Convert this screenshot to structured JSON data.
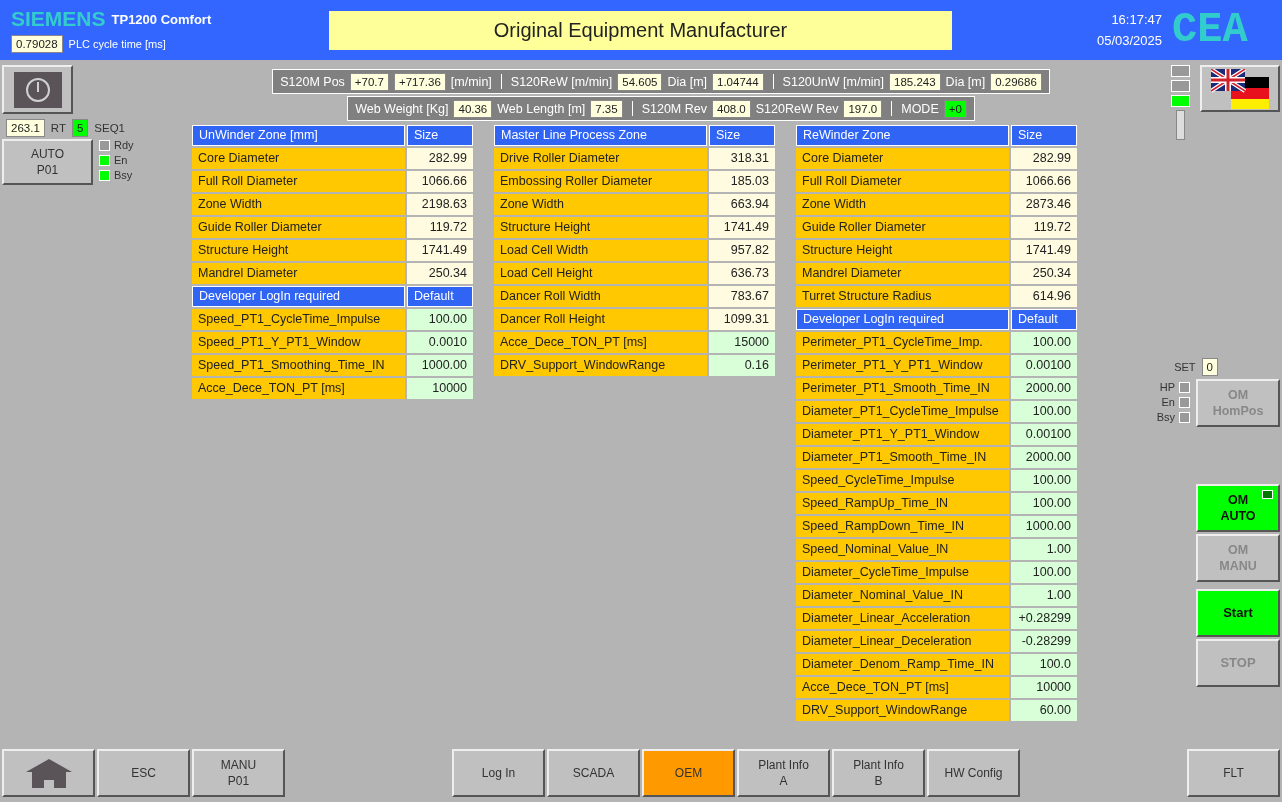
{
  "header": {
    "brand": "SIEMENS",
    "model": "TP1200 Comfort",
    "cycle_time": "0.79028",
    "cycle_time_label": "PLC cycle time [ms]",
    "title": "Original Equipment Manufacturer",
    "time": "16:17:47",
    "date": "05/03/2025",
    "logo": "CEA"
  },
  "left_panel": {
    "rt_value": "263.1",
    "rt_label": "RT",
    "seq_value": "5",
    "seq_label": "SEQ1",
    "mode_button": "AUTO\nP01",
    "indicators": [
      {
        "label": "Rdy",
        "on": false
      },
      {
        "label": "En",
        "on": true
      },
      {
        "label": "Bsy",
        "on": true
      }
    ]
  },
  "info_bars": [
    {
      "items": [
        {
          "kind": "label",
          "text": "S120M Pos"
        },
        {
          "kind": "value",
          "text": "+70.7"
        },
        {
          "kind": "value",
          "text": "+717.36"
        },
        {
          "kind": "label",
          "text": "[m/min]"
        },
        {
          "kind": "separator"
        },
        {
          "kind": "label",
          "text": "S120ReW [m/min]"
        },
        {
          "kind": "value",
          "text": "54.605"
        },
        {
          "kind": "label",
          "text": "Dia [m]"
        },
        {
          "kind": "value",
          "text": "1.04744"
        },
        {
          "kind": "separator"
        },
        {
          "kind": "label",
          "text": "S120UnW [m/min]"
        },
        {
          "kind": "value",
          "text": "185.243"
        },
        {
          "kind": "label",
          "text": "Dia [m]"
        },
        {
          "kind": "value",
          "text": "0.29686"
        }
      ]
    },
    {
      "items": [
        {
          "kind": "label",
          "text": "Web Weight [Kg]"
        },
        {
          "kind": "value",
          "text": "40.36"
        },
        {
          "kind": "label",
          "text": "Web Length [m]"
        },
        {
          "kind": "value",
          "text": "7.35"
        },
        {
          "kind": "separator"
        },
        {
          "kind": "label",
          "text": "S120M Rev"
        },
        {
          "kind": "value",
          "text": "408.0"
        },
        {
          "kind": "label",
          "text": "S120ReW Rev"
        },
        {
          "kind": "value",
          "text": "197.0"
        },
        {
          "kind": "separator"
        },
        {
          "kind": "label",
          "text": "MODE"
        },
        {
          "kind": "active_value",
          "text": "+0"
        }
      ]
    }
  ],
  "tables": [
    {
      "rows": [
        {
          "kind": "header",
          "label": "UnWinder Zone [mm]",
          "value": "Size"
        },
        {
          "kind": "size",
          "label": "Core Diameter",
          "value": "282.99"
        },
        {
          "kind": "size",
          "label": "Full Roll Diameter",
          "value": "1066.66"
        },
        {
          "kind": "size",
          "label": "Zone Width",
          "value": "2198.63"
        },
        {
          "kind": "size",
          "label": "Guide Roller Diameter",
          "value": "119.72"
        },
        {
          "kind": "size",
          "label": "Structure Height",
          "value": "1741.49"
        },
        {
          "kind": "size",
          "label": "Mandrel Diameter",
          "value": "250.34"
        },
        {
          "kind": "header",
          "label": "Developer LogIn required",
          "value": "Default"
        },
        {
          "kind": "default",
          "label": "Speed_PT1_CycleTime_Impulse",
          "value": "100.00"
        },
        {
          "kind": "default",
          "label": "Speed_PT1_Y_PT1_Window",
          "value": "0.0010"
        },
        {
          "kind": "default",
          "label": "Speed_PT1_Smoothing_Time_IN",
          "value": "1000.00"
        },
        {
          "kind": "default",
          "label": "Acce_Dece_TON_PT [ms]",
          "value": "10000"
        }
      ]
    },
    {
      "rows": [
        {
          "kind": "header",
          "label": "Master Line Process Zone",
          "value": "Size"
        },
        {
          "kind": "size",
          "label": "Drive Roller Diameter",
          "value": "318.31"
        },
        {
          "kind": "size",
          "label": "Embossing Roller Diameter",
          "value": "185.03"
        },
        {
          "kind": "size",
          "label": "Zone Width",
          "value": "663.94"
        },
        {
          "kind": "size",
          "label": "Structure Height",
          "value": "1741.49"
        },
        {
          "kind": "size",
          "label": "Load Cell Width",
          "value": "957.82"
        },
        {
          "kind": "size",
          "label": "Load Cell Height",
          "value": "636.73"
        },
        {
          "kind": "size",
          "label": "Dancer Roll Width",
          "value": "783.67"
        },
        {
          "kind": "size",
          "label": "Dancer Roll Height",
          "value": "1099.31"
        },
        {
          "kind": "default",
          "label": "Acce_Dece_TON_PT [ms]",
          "value": "15000"
        },
        {
          "kind": "default",
          "label": "DRV_Support_WindowRange",
          "value": "0.16"
        }
      ]
    },
    {
      "rows": [
        {
          "kind": "header",
          "label": "ReWinder Zone",
          "value": "Size"
        },
        {
          "kind": "size",
          "label": "Core Diameter",
          "value": "282.99"
        },
        {
          "kind": "size",
          "label": "Full Roll Diameter",
          "value": "1066.66"
        },
        {
          "kind": "size",
          "label": "Zone Width",
          "value": "2873.46"
        },
        {
          "kind": "size",
          "label": "Guide Roller Diameter",
          "value": "119.72"
        },
        {
          "kind": "size",
          "label": "Structure Height",
          "value": "1741.49"
        },
        {
          "kind": "size",
          "label": "Mandrel Diameter",
          "value": "250.34"
        },
        {
          "kind": "size",
          "label": "Turret Structure Radius",
          "value": "614.96"
        },
        {
          "kind": "header",
          "label": "Developer LogIn required",
          "value": "Default"
        },
        {
          "kind": "default",
          "label": "Perimeter_PT1_CycleTime_Imp.",
          "value": "100.00"
        },
        {
          "kind": "default",
          "label": "Perimeter_PT1_Y_PT1_Window",
          "value": "0.00100"
        },
        {
          "kind": "default",
          "label": "Perimeter_PT1_Smooth_Time_IN",
          "value": "2000.00"
        },
        {
          "kind": "default",
          "label": "Diameter_PT1_CycleTime_Impulse",
          "value": "100.00"
        },
        {
          "kind": "default",
          "label": "Diameter_PT1_Y_PT1_Window",
          "value": "0.00100"
        },
        {
          "kind": "default",
          "label": "Diameter_PT1_Smooth_Time_IN",
          "value": "2000.00"
        },
        {
          "kind": "default",
          "label": "Speed_CycleTime_Impulse",
          "value": "100.00"
        },
        {
          "kind": "default",
          "label": "Speed_RampUp_Time_IN",
          "value": "100.00"
        },
        {
          "kind": "default",
          "label": "Speed_RampDown_Time_IN",
          "value": "1000.00"
        },
        {
          "kind": "default",
          "label": "Speed_Nominal_Value_IN",
          "value": "1.00"
        },
        {
          "kind": "default",
          "label": "Diameter_CycleTime_Impulse",
          "value": "100.00"
        },
        {
          "kind": "default",
          "label": "Diameter_Nominal_Value_IN",
          "value": "1.00"
        },
        {
          "kind": "default",
          "label": "Diameter_Linear_Acceleration",
          "value": "+0.28299"
        },
        {
          "kind": "default",
          "label": "Diameter_Linear_Deceleration",
          "value": "-0.28299"
        },
        {
          "kind": "default",
          "label": "Diameter_Denom_Ramp_Time_IN",
          "value": "100.0"
        },
        {
          "kind": "default",
          "label": "Acce_Dece_TON_PT [ms]",
          "value": "10000"
        },
        {
          "kind": "default",
          "label": "DRV_Support_WindowRange",
          "value": "60.00"
        }
      ]
    }
  ],
  "right_panel": {
    "lights": [
      {
        "on": false
      },
      {
        "on": false
      },
      {
        "on": true
      }
    ],
    "set_label": "SET",
    "set_value": "0",
    "indicators": [
      {
        "label": "HP",
        "on": false
      },
      {
        "label": "En",
        "on": false
      },
      {
        "label": "Bsy",
        "on": false
      }
    ],
    "homing_button": {
      "label": "OM\nHomPos",
      "active": false
    },
    "mode_buttons": [
      {
        "label": "OM\nAUTO",
        "active": true,
        "lamp": true
      },
      {
        "label": "OM\nMANU",
        "active": false,
        "lamp": false
      }
    ],
    "run_buttons": [
      {
        "label": "Start",
        "active": true
      },
      {
        "label": "STOP",
        "active": false
      }
    ]
  },
  "footer": {
    "left": [
      {
        "kind": "home"
      },
      {
        "kind": "text",
        "label": "ESC"
      },
      {
        "kind": "text",
        "label": "MANU\nP01"
      }
    ],
    "nav": [
      {
        "label": "Log In",
        "selected": false
      },
      {
        "label": "SCADA",
        "selected": false
      },
      {
        "label": "OEM",
        "selected": true
      },
      {
        "label": "Plant Info\nA",
        "selected": false
      },
      {
        "label": "Plant Info\nB",
        "selected": false
      },
      {
        "label": "HW Config",
        "selected": false
      }
    ],
    "right": [
      {
        "kind": "text",
        "label": "FLT"
      }
    ]
  }
}
